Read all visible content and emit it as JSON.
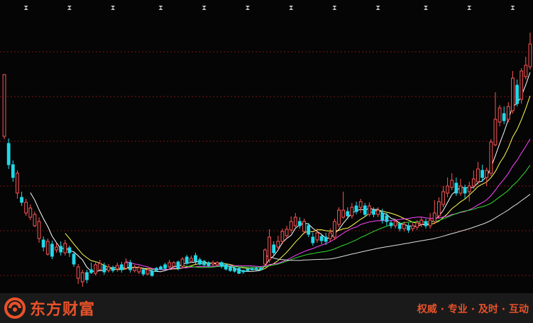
{
  "chart_data": {
    "type": "candlestick",
    "colors": {
      "up": "#ff5555",
      "down": "#22d8e8",
      "grid": "#7a1414",
      "background": "#050505",
      "marker": "#c8c8c8",
      "ma5": "#ffffff",
      "ma10": "#ffff55",
      "ma20": "#ff44ff",
      "ma30": "#33dd33",
      "ma60": "#dddddd"
    },
    "candles": [
      {
        "o": 192,
        "c": 105,
        "h": 110,
        "l": 196
      },
      {
        "o": 202,
        "c": 232,
        "h": 195,
        "l": 238
      },
      {
        "o": 232,
        "c": 250,
        "h": 226,
        "l": 256
      },
      {
        "o": 272,
        "c": 244,
        "h": 240,
        "l": 280
      },
      {
        "o": 278,
        "c": 285,
        "h": 270,
        "l": 290
      },
      {
        "o": 300,
        "c": 285,
        "h": 280,
        "l": 304
      },
      {
        "o": 306,
        "c": 293,
        "h": 288,
        "l": 310
      },
      {
        "o": 318,
        "c": 302,
        "h": 298,
        "l": 320
      },
      {
        "o": 336,
        "c": 312,
        "h": 306,
        "l": 342
      },
      {
        "o": 338,
        "c": 348,
        "h": 333,
        "l": 354
      },
      {
        "o": 358,
        "c": 340,
        "h": 336,
        "l": 360
      },
      {
        "o": 344,
        "c": 361,
        "h": 339,
        "l": 365
      },
      {
        "o": 352,
        "c": 348,
        "h": 343,
        "l": 356
      },
      {
        "o": 347,
        "c": 355,
        "h": 340,
        "l": 360
      },
      {
        "o": 356,
        "c": 343,
        "h": 338,
        "l": 360
      },
      {
        "o": 349,
        "c": 356,
        "h": 346,
        "l": 362
      },
      {
        "o": 358,
        "c": 372,
        "h": 354,
        "l": 376
      },
      {
        "o": 392,
        "c": 376,
        "h": 372,
        "l": 400
      },
      {
        "o": 397,
        "c": 384,
        "h": 380,
        "l": 404
      },
      {
        "o": 384,
        "c": 394,
        "h": 380,
        "l": 399
      },
      {
        "o": 380,
        "c": 384,
        "h": 370,
        "l": 386
      },
      {
        "o": 385,
        "c": 373,
        "h": 368,
        "l": 388
      },
      {
        "o": 380,
        "c": 371,
        "h": 366,
        "l": 382
      },
      {
        "o": 374,
        "c": 383,
        "h": 370,
        "l": 387
      },
      {
        "o": 381,
        "c": 376,
        "h": 372,
        "l": 384
      },
      {
        "o": 377,
        "c": 381,
        "h": 374,
        "l": 384
      },
      {
        "o": 379,
        "c": 374,
        "h": 370,
        "l": 383
      },
      {
        "o": 373,
        "c": 380,
        "h": 369,
        "l": 384
      },
      {
        "o": 378,
        "c": 370,
        "h": 364,
        "l": 380
      },
      {
        "o": 370,
        "c": 380,
        "h": 366,
        "l": 384
      },
      {
        "o": 381,
        "c": 377,
        "h": 373,
        "l": 384
      },
      {
        "o": 383,
        "c": 377,
        "h": 374,
        "l": 386
      },
      {
        "o": 380,
        "c": 386,
        "h": 377,
        "l": 389
      },
      {
        "o": 386,
        "c": 380,
        "h": 378,
        "l": 388
      },
      {
        "o": 382,
        "c": 388,
        "h": 379,
        "l": 390
      },
      {
        "o": 378,
        "c": 381,
        "h": 376,
        "l": 383
      },
      {
        "o": 376,
        "c": 379,
        "h": 374,
        "l": 380
      },
      {
        "o": 373,
        "c": 378,
        "h": 370,
        "l": 381
      },
      {
        "o": 376,
        "c": 370,
        "h": 366,
        "l": 379
      },
      {
        "o": 375,
        "c": 370,
        "h": 368,
        "l": 377
      },
      {
        "o": 369,
        "c": 378,
        "h": 367,
        "l": 381
      },
      {
        "o": 375,
        "c": 365,
        "h": 362,
        "l": 377
      },
      {
        "o": 362,
        "c": 371,
        "h": 359,
        "l": 373
      },
      {
        "o": 368,
        "c": 364,
        "h": 360,
        "l": 370
      },
      {
        "o": 360,
        "c": 368,
        "h": 356,
        "l": 372
      },
      {
        "o": 366,
        "c": 372,
        "h": 363,
        "l": 374
      },
      {
        "o": 368,
        "c": 373,
        "h": 366,
        "l": 375
      },
      {
        "o": 370,
        "c": 374,
        "h": 368,
        "l": 376
      },
      {
        "o": 372,
        "c": 370,
        "h": 367,
        "l": 375
      },
      {
        "o": 373,
        "c": 370,
        "h": 368,
        "l": 375
      },
      {
        "o": 370,
        "c": 375,
        "h": 368,
        "l": 378
      },
      {
        "o": 373,
        "c": 379,
        "h": 371,
        "l": 381
      },
      {
        "o": 376,
        "c": 381,
        "h": 374,
        "l": 383
      },
      {
        "o": 378,
        "c": 382,
        "h": 376,
        "l": 384
      },
      {
        "o": 378,
        "c": 385,
        "h": 376,
        "l": 386
      },
      {
        "o": 381,
        "c": 383,
        "h": 380,
        "l": 386
      },
      {
        "o": 379,
        "c": 381,
        "h": 378,
        "l": 383
      },
      {
        "o": 378,
        "c": 380,
        "h": 377,
        "l": 381
      },
      {
        "o": 378,
        "c": 380,
        "h": 376,
        "l": 381
      },
      {
        "o": 378,
        "c": 380,
        "h": 376,
        "l": 381
      },
      {
        "o": 372,
        "c": 352,
        "h": 350,
        "l": 375
      },
      {
        "o": 366,
        "c": 334,
        "h": 323,
        "l": 370
      },
      {
        "o": 345,
        "c": 356,
        "h": 340,
        "l": 360
      },
      {
        "o": 348,
        "c": 340,
        "h": 332,
        "l": 352
      },
      {
        "o": 340,
        "c": 326,
        "h": 322,
        "l": 344
      },
      {
        "o": 332,
        "c": 323,
        "h": 318,
        "l": 336
      },
      {
        "o": 324,
        "c": 312,
        "h": 305,
        "l": 328
      },
      {
        "o": 318,
        "c": 306,
        "h": 300,
        "l": 320
      },
      {
        "o": 312,
        "c": 318,
        "h": 306,
        "l": 322
      },
      {
        "o": 326,
        "c": 312,
        "h": 308,
        "l": 330
      },
      {
        "o": 318,
        "c": 330,
        "h": 314,
        "l": 334
      },
      {
        "o": 334,
        "c": 342,
        "h": 328,
        "l": 346
      },
      {
        "o": 338,
        "c": 328,
        "h": 322,
        "l": 342
      },
      {
        "o": 333,
        "c": 339,
        "h": 329,
        "l": 344
      },
      {
        "o": 334,
        "c": 340,
        "h": 328,
        "l": 345
      },
      {
        "o": 336,
        "c": 328,
        "h": 322,
        "l": 340
      },
      {
        "o": 334,
        "c": 312,
        "h": 308,
        "l": 338
      },
      {
        "o": 316,
        "c": 296,
        "h": 292,
        "l": 320
      },
      {
        "o": 306,
        "c": 296,
        "h": 270,
        "l": 308
      },
      {
        "o": 298,
        "c": 304,
        "h": 292,
        "l": 309
      },
      {
        "o": 304,
        "c": 292,
        "h": 286,
        "l": 308
      },
      {
        "o": 290,
        "c": 298,
        "h": 284,
        "l": 302
      },
      {
        "o": 292,
        "c": 284,
        "h": 280,
        "l": 300
      },
      {
        "o": 290,
        "c": 302,
        "h": 286,
        "l": 306
      },
      {
        "o": 302,
        "c": 290,
        "h": 285,
        "l": 305
      },
      {
        "o": 296,
        "c": 302,
        "h": 292,
        "l": 306
      },
      {
        "o": 302,
        "c": 296,
        "h": 292,
        "l": 306
      },
      {
        "o": 300,
        "c": 310,
        "h": 294,
        "l": 315
      },
      {
        "o": 304,
        "c": 312,
        "h": 300,
        "l": 318
      },
      {
        "o": 314,
        "c": 318,
        "h": 310,
        "l": 322
      },
      {
        "o": 318,
        "c": 312,
        "h": 308,
        "l": 322
      },
      {
        "o": 316,
        "c": 322,
        "h": 312,
        "l": 326
      },
      {
        "o": 322,
        "c": 316,
        "h": 312,
        "l": 326
      },
      {
        "o": 318,
        "c": 324,
        "h": 314,
        "l": 328
      },
      {
        "o": 322,
        "c": 318,
        "h": 314,
        "l": 326
      },
      {
        "o": 320,
        "c": 314,
        "h": 310,
        "l": 324
      },
      {
        "o": 316,
        "c": 310,
        "h": 306,
        "l": 320
      },
      {
        "o": 312,
        "c": 318,
        "h": 308,
        "l": 322
      },
      {
        "o": 318,
        "c": 310,
        "h": 300,
        "l": 322
      },
      {
        "o": 312,
        "c": 300,
        "h": 282,
        "l": 316
      },
      {
        "o": 304,
        "c": 284,
        "h": 278,
        "l": 308
      },
      {
        "o": 288,
        "c": 270,
        "h": 262,
        "l": 292
      },
      {
        "o": 272,
        "c": 262,
        "h": 250,
        "l": 278
      },
      {
        "o": 264,
        "c": 254,
        "h": 244,
        "l": 268
      },
      {
        "o": 258,
        "c": 272,
        "h": 250,
        "l": 276
      },
      {
        "o": 272,
        "c": 262,
        "h": 252,
        "l": 276
      },
      {
        "o": 264,
        "c": 272,
        "h": 260,
        "l": 280
      },
      {
        "o": 270,
        "c": 262,
        "h": 256,
        "l": 284
      },
      {
        "o": 262,
        "c": 252,
        "h": 240,
        "l": 266
      },
      {
        "o": 256,
        "c": 238,
        "h": 228,
        "l": 260
      },
      {
        "o": 240,
        "c": 250,
        "h": 232,
        "l": 256
      },
      {
        "o": 250,
        "c": 240,
        "h": 236,
        "l": 262
      },
      {
        "o": 244,
        "c": 200,
        "h": 196,
        "l": 248
      },
      {
        "o": 204,
        "c": 168,
        "h": 130,
        "l": 206
      },
      {
        "o": 172,
        "c": 152,
        "h": 148,
        "l": 178
      },
      {
        "o": 160,
        "c": 170,
        "h": 150,
        "l": 175
      },
      {
        "o": 168,
        "c": 150,
        "h": 144,
        "l": 172
      },
      {
        "o": 156,
        "c": 110,
        "h": 100,
        "l": 160
      },
      {
        "o": 120,
        "c": 146,
        "h": 112,
        "l": 150
      },
      {
        "o": 140,
        "c": 100,
        "h": 96,
        "l": 146
      },
      {
        "o": 108,
        "c": 92,
        "h": 80,
        "l": 112
      },
      {
        "o": 94,
        "c": 62,
        "h": 46,
        "l": 98
      }
    ],
    "moving_averages": [
      {
        "name": "ma5",
        "start": 6
      },
      {
        "name": "ma10",
        "start": 14
      },
      {
        "name": "ma20",
        "start": 28
      },
      {
        "name": "ma30",
        "start": 40
      },
      {
        "name": "ma60",
        "start": 60
      }
    ],
    "top_markers_count": 12
  },
  "branding": {
    "logo_text": "东方财富",
    "slogan": "权威 · 专业 · 及时 · 互动"
  }
}
